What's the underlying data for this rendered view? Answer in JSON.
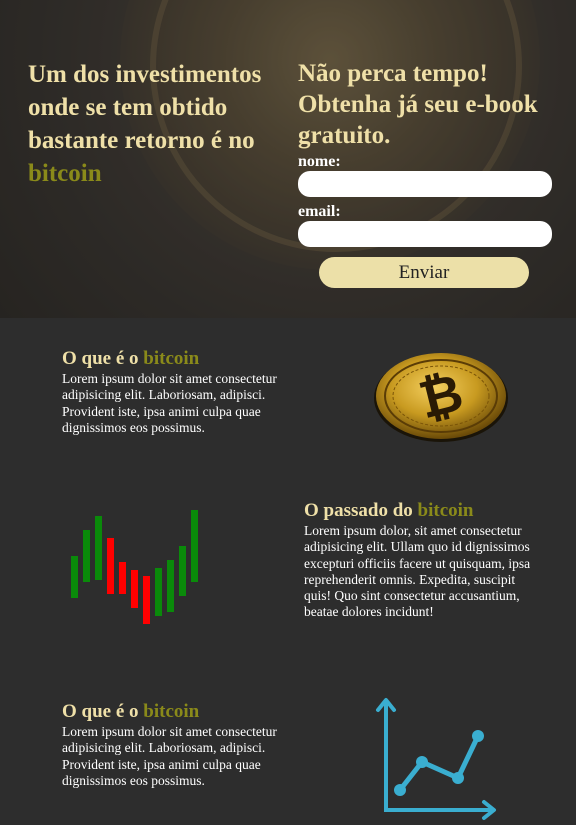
{
  "hero": {
    "title": "Um dos investimentos onde se tem obtido bastante retorno é no ",
    "title_accent": "bitcoin"
  },
  "form": {
    "title": "Não perca tempo! Obtenha já seu e-book gratuito.",
    "name_label": "nome:",
    "email_label": "email:",
    "name_value": "",
    "email_value": "",
    "submit_label": "Enviar"
  },
  "sections": [
    {
      "title": "O que é o ",
      "title_accent": "bitcoin",
      "body": "Lorem ipsum dolor sit amet consectetur adipisicing elit. Laboriosam, adipisci. Provident iste, ipsa animi culpa quae dignissimos eos possimus.",
      "image": "bitcoin-coin-icon"
    },
    {
      "title": "O passado do ",
      "title_accent": "bitcoin",
      "body": "Lorem ipsum dolor, sit amet consectetur adipisicing elit. Ullam quo id dignissimos excepturi officiis facere ut quisquam, ipsa reprehenderit omnis. Expedita, suscipit quis! Quo sint consectetur accusantium, beatae dolores incidunt!",
      "image": "candlestick-chart-icon"
    },
    {
      "title": "O que é o ",
      "title_accent": "bitcoin",
      "body": "Lorem ipsum dolor sit amet consectetur adipisicing elit. Laboriosam, adipisci. Provident iste, ipsa animi culpa quae dignissimos eos possimus.",
      "image": "line-chart-icon"
    }
  ],
  "colors": {
    "accent_gold": "#efe0a8",
    "accent_olive": "#8a8a1a",
    "background": "#2d2d2d",
    "candle_up": "#0a8a0a",
    "candle_down": "#ff0000",
    "chart_icon": "#3aaed0"
  }
}
